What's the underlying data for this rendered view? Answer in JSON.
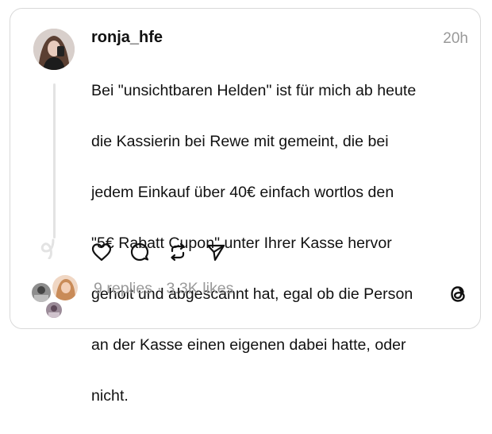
{
  "post": {
    "username": "ronja_hfe",
    "timestamp": "20h",
    "lines": [
      "Bei \"unsichtbaren Helden\" ist für mich ab heute",
      "die Kassierin bei Rewe mit gemeint, die bei",
      "jedem Einkauf über 40€ einfach wortlos den",
      "\"5€ Rabatt Cupon\" unter Ihrer Kasse hervor",
      "geholt und abgescannt hat, egal ob die Person",
      "an der Kasse einen eigenen dabei hatte, oder",
      "nicht."
    ]
  },
  "stats": {
    "replies": "9 replies",
    "separator": "·",
    "likes": "3.3K likes"
  },
  "icons": {
    "like": "heart-icon",
    "reply": "comment-icon",
    "repost": "repost-icon",
    "share": "send-icon",
    "brand": "threads-logo-icon"
  },
  "colors": {
    "text": "#111111",
    "muted": "#999999",
    "border": "#d9d9d9"
  }
}
